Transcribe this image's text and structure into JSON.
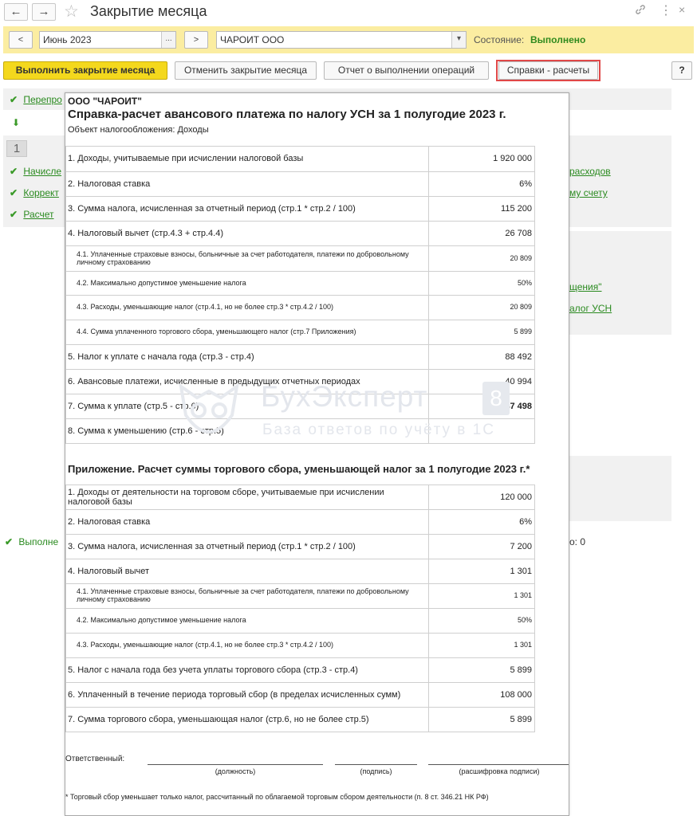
{
  "window": {
    "title": "Закрытие месяца",
    "back_icon": "←",
    "forward_icon": "→",
    "favorite_icon": "☆",
    "link_icon": "🔗",
    "more_icon": "⋮",
    "close_icon": "×"
  },
  "period_bar": {
    "prev_label": "<",
    "next_label": ">",
    "period": "Июнь 2023",
    "period_btn": "...",
    "organization": "ЧАРОИТ ООО",
    "org_btn": "▾",
    "state_label": "Состояние:",
    "state_value": "Выполнено"
  },
  "toolbar": {
    "run_close": "Выполнить закрытие месяца",
    "cancel_close": "Отменить закрытие месяца",
    "operations_report": "Отчет о выполнении операций",
    "references": "Справки - расчеты",
    "help": "?"
  },
  "background": {
    "row1": "Перепро",
    "arrow": "⬇",
    "step_number": "1",
    "row2": "Начисле",
    "row3": "Коррект",
    "row4": "Расчет",
    "right1": "расходов",
    "right2": "му счету",
    "right3": "щения\"",
    "right4": "алог УСН",
    "bottom_status": "Выполне",
    "bottom_right": "о: 0",
    "check_icon": "✔"
  },
  "report": {
    "organization": "ООО \"ЧАРОИТ\"",
    "title": "Справка-расчет авансового платежа по налогу УСН за 1 полугодие 2023 г.",
    "object": "Объект налогообложения:   Доходы",
    "rows": [
      {
        "name": "1. Доходы, учитываемые при исчислении налоговой базы",
        "value": "1 920 000"
      },
      {
        "name": "2. Налоговая ставка",
        "value": "6%"
      },
      {
        "name": "3. Сумма налога, исчисленная за отчетный период (стр.1 * стр.2 / 100)",
        "value": "115 200"
      },
      {
        "name": "4. Налоговый вычет (стр.4.3 + стр.4.4)",
        "value": "26 708"
      },
      {
        "name": "4.1. Уплаченные страховые взносы, больничные за счет работодателя, платежи по добровольному личному страхованию",
        "value": "20 809"
      },
      {
        "name": "4.2. Максимально допустимое уменьшение налога",
        "value": "50%"
      },
      {
        "name": "4.3. Расходы, уменьшающие налог (стр.4.1, но не более стр.3 * стр.4.2 / 100)",
        "value": "20 809"
      },
      {
        "name": "4.4. Сумма уплаченного торгового сбора, уменьшающего налог (стр.7 Приложения)",
        "value": "5 899"
      },
      {
        "name": "5. Налог к уплате с начала года (стр.3 - стр.4)",
        "value": "88 492"
      },
      {
        "name": "6. Авансовые платежи, исчисленные в предыдущих отчетных периодах",
        "value": "40 994"
      },
      {
        "name": "7. Сумма к уплате (стр.5 - стр.6)",
        "value": "47 498"
      },
      {
        "name": "8. Сумма к уменьшению (стр.6 - стр.5)",
        "value": ""
      }
    ],
    "appendix_title": "Приложение. Расчет суммы торгового сбора, уменьшающей налог за 1 полугодие 2023 г.*",
    "appendix_rows": [
      {
        "name": "1. Доходы от деятельности на торговом сборе, учитываемые при исчислении налоговой базы",
        "value": "120 000"
      },
      {
        "name": "2. Налоговая ставка",
        "value": "6%"
      },
      {
        "name": "3. Сумма налога, исчисленная за отчетный период (стр.1 * стр.2 / 100)",
        "value": "7 200"
      },
      {
        "name": "4. Налоговый вычет",
        "value": "1 301"
      },
      {
        "name": "4.1. Уплаченные страховые взносы, больничные за счет работодателя, платежи по добровольному личному страхованию",
        "value": "1 301"
      },
      {
        "name": "4.2. Максимально допустимое уменьшение налога",
        "value": "50%"
      },
      {
        "name": "4.3. Расходы, уменьшающие налог (стр.4.1, но не более стр.3 * стр.4.2 / 100)",
        "value": "1 301"
      },
      {
        "name": "5. Налог с начала года без учета уплаты торгового сбора (стр.3 - стр.4)",
        "value": "5 899"
      },
      {
        "name": "6. Уплаченный в течение периода торговый сбор (в пределах исчисленных сумм)",
        "value": "108 000"
      },
      {
        "name": "7. Сумма торгового сбора, уменьшающая налог (стр.6, но не более стр.5)",
        "value": "5 899"
      }
    ],
    "responsible_label": "Ответственный:",
    "sign_position": "(должность)",
    "sign_signature": "(подпись)",
    "sign_decoding": "(расшифровка подписи)",
    "footnote": "* Торговый сбор уменьшает только налог, рассчитанный по облагаемой торговым сбором деятельности (п. 8 ст. 346.21 НК РФ)"
  },
  "watermark": {
    "title": "БухЭксперт",
    "badge": "8",
    "subtitle": "База ответов по учёту в 1С"
  }
}
